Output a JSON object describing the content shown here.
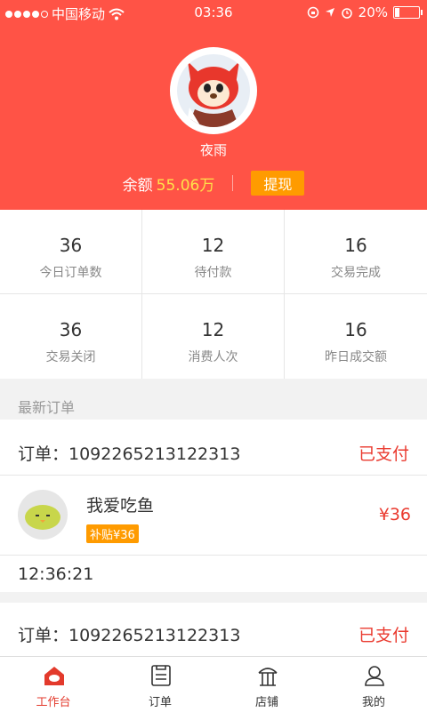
{
  "status_bar": {
    "carrier": "中国移动",
    "time": "03:36",
    "battery": "20%"
  },
  "profile": {
    "username": "夜雨",
    "balance_label": "余额",
    "balance_value": "55.06万",
    "withdraw_label": "提现"
  },
  "stats": [
    {
      "value": "36",
      "label": "今日订单数"
    },
    {
      "value": "12",
      "label": "待付款"
    },
    {
      "value": "16",
      "label": "交易完成"
    },
    {
      "value": "36",
      "label": "交易关闭"
    },
    {
      "value": "12",
      "label": "消费人次"
    },
    {
      "value": "16",
      "label": "昨日成交额"
    }
  ],
  "orders_section": {
    "title": "最新订单",
    "orders": [
      {
        "order_label": "订单：1092265213122313",
        "status": "已支付",
        "item_name": "我爱吃鱼",
        "subsidy": "补贴¥36",
        "price": "¥36",
        "time": "12:36:21"
      },
      {
        "order_label": "订单：1092265213122313",
        "status": "已支付"
      }
    ]
  },
  "tabbar": {
    "tabs": [
      {
        "label": "工作台",
        "icon": "workbench-icon"
      },
      {
        "label": "订单",
        "icon": "order-icon"
      },
      {
        "label": "店铺",
        "icon": "shop-icon"
      },
      {
        "label": "我的",
        "icon": "user-icon"
      }
    ]
  },
  "colors": {
    "header_bg": "#ff5346",
    "accent_orange": "#ff9b00",
    "status_red": "#ea3a2f",
    "balance_yellow": "#ffe14a"
  }
}
